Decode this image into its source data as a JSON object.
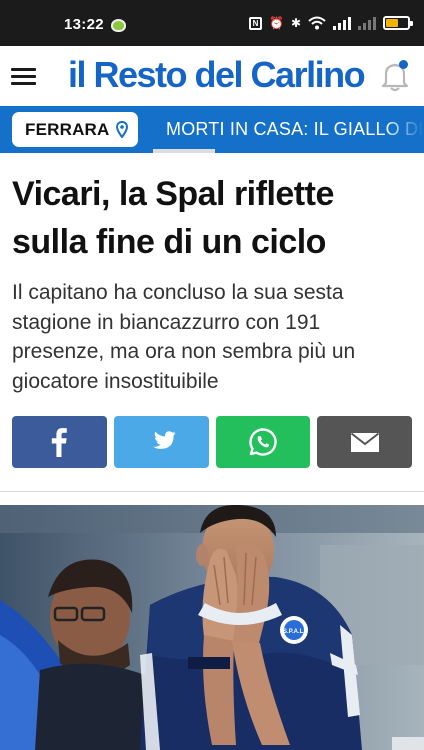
{
  "status_bar": {
    "time": "13:22"
  },
  "header": {
    "logo_text": "il Resto del Carlino",
    "menu_icon": "hamburger-menu-icon",
    "notification_icon": "bell-icon"
  },
  "city_selector": {
    "label": "FERRARA",
    "icon": "location-pin-icon"
  },
  "ticker": {
    "text": "MORTI IN CASA: IL GIALLO DI"
  },
  "article": {
    "title": "Vicari, la Spal riflette sulla fine di un ciclo",
    "subtitle": "Il capitano ha concluso la sua sesta stagione in biancazzurro con 191 presenze, ma ora non sembra più un giocatore insostituibile"
  },
  "share": [
    {
      "network": "facebook",
      "icon": "facebook-icon"
    },
    {
      "network": "twitter",
      "icon": "twitter-icon"
    },
    {
      "network": "whatsapp",
      "icon": "whatsapp-icon"
    },
    {
      "network": "email",
      "icon": "envelope-icon"
    }
  ],
  "photo": {
    "jersey_text": "S.P.A.L."
  },
  "colors": {
    "brand_blue": "#1565c8",
    "ticker_blue": "#1470c8",
    "facebook": "#3b5b9a",
    "twitter": "#4aa9e6",
    "whatsapp": "#24bf5d",
    "email": "#555555"
  }
}
